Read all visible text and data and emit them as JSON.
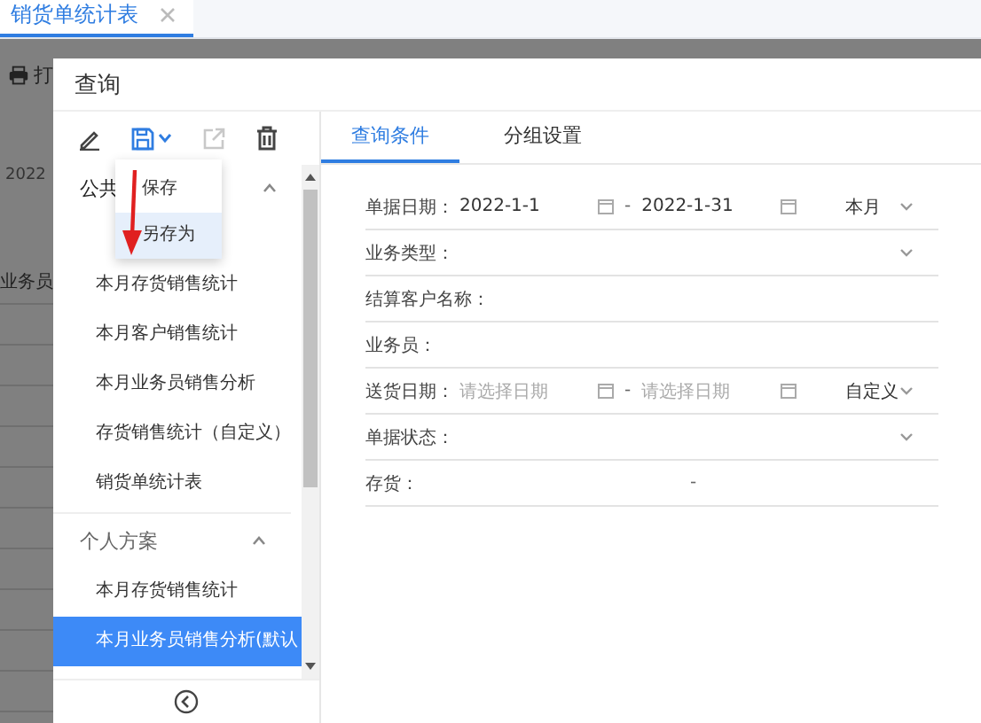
{
  "page": {
    "tab": {
      "label": "销货单统计表",
      "selected": true
    },
    "toolbar_label": "打",
    "texts": [
      "2022",
      "业务员"
    ]
  },
  "dialog": {
    "title": "查询",
    "toolbar": [
      {
        "kind": "edit",
        "disabled": false
      },
      {
        "kind": "save",
        "disabled": false
      },
      {
        "kind": "export",
        "disabled": true
      },
      {
        "kind": "delete",
        "disabled": false
      }
    ],
    "save_menu": [
      {
        "label": "保存",
        "selected": false
      },
      {
        "label": "另存为",
        "selected": true
      }
    ],
    "schemes": [
      {
        "title": "公共",
        "expanded": true,
        "items": [
          {
            "label": "本月存货销售统计",
            "selected": false
          },
          {
            "label": "本月客户销售统计",
            "selected": false
          },
          {
            "label": "本月业务员销售分析",
            "selected": false
          },
          {
            "label": "存货销售统计（自定义）",
            "selected": false
          },
          {
            "label": "销货单统计表",
            "selected": false
          }
        ]
      },
      {
        "title": "个人方案",
        "expanded": true,
        "items": [
          {
            "label": "本月存货销售统计",
            "selected": false
          },
          {
            "label": "本月业务员销售分析(默认",
            "selected": true
          }
        ]
      }
    ],
    "tabs": [
      {
        "label": "查询条件",
        "selected": true
      },
      {
        "label": "分组设置",
        "selected": false
      }
    ],
    "fields": [
      {
        "kind": "date_range",
        "label": "单据日期：",
        "start": {
          "value": "2022-1-1"
        },
        "separator": "-",
        "end": {
          "value": "2022-1-31"
        },
        "preset": "本月"
      },
      {
        "kind": "select",
        "label": "业务类型："
      },
      {
        "kind": "text",
        "label": "结算客户名称："
      },
      {
        "kind": "text",
        "label": "业务员："
      },
      {
        "kind": "date_range",
        "label": "送货日期：",
        "start": {
          "placeholder": "请选择日期"
        },
        "separator": "-",
        "end": {
          "placeholder": "请选择日期"
        },
        "preset": "自定义"
      },
      {
        "kind": "select",
        "label": "单据状态："
      },
      {
        "kind": "range",
        "label": "存货：",
        "separator": "-"
      }
    ]
  }
}
